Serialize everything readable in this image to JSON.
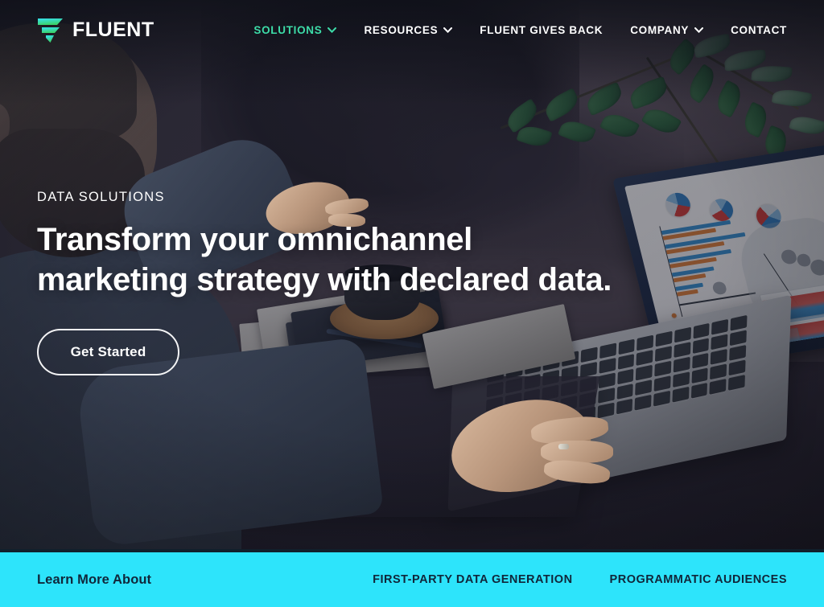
{
  "brand": {
    "name": "FLUENT",
    "logo_icon": "fluent-funnel-logo",
    "logo_colors": [
      "#35E0F0",
      "#3BD37A"
    ]
  },
  "nav": {
    "items": [
      {
        "label": "SOLUTIONS",
        "has_dropdown": true,
        "active": true,
        "icon": "chevron-down-icon"
      },
      {
        "label": "RESOURCES",
        "has_dropdown": true,
        "active": false,
        "icon": "chevron-down-icon"
      },
      {
        "label": "FLUENT GIVES BACK",
        "has_dropdown": false,
        "active": false
      },
      {
        "label": "COMPANY",
        "has_dropdown": true,
        "active": false,
        "icon": "chevron-down-icon"
      },
      {
        "label": "CONTACT",
        "has_dropdown": false,
        "active": false
      }
    ],
    "active_color": "#3ddca8",
    "text_color": "#ffffff"
  },
  "hero": {
    "eyebrow": "DATA SOLUTIONS",
    "headline_line1": "Transform your omnichannel",
    "headline_line2": "marketing strategy with declared data.",
    "cta_label": "Get Started",
    "background_description": "Bearded man in denim shirt working on a laptop showing an analytics dashboard, with coffee cup, notebooks and a plant"
  },
  "learn_bar": {
    "title": "Learn More About",
    "background_color": "#2de4fb",
    "text_color": "#10263a",
    "links": [
      {
        "label": "FIRST-PARTY DATA GENERATION"
      },
      {
        "label": "PROGRAMMATIC AUDIENCES"
      }
    ]
  }
}
